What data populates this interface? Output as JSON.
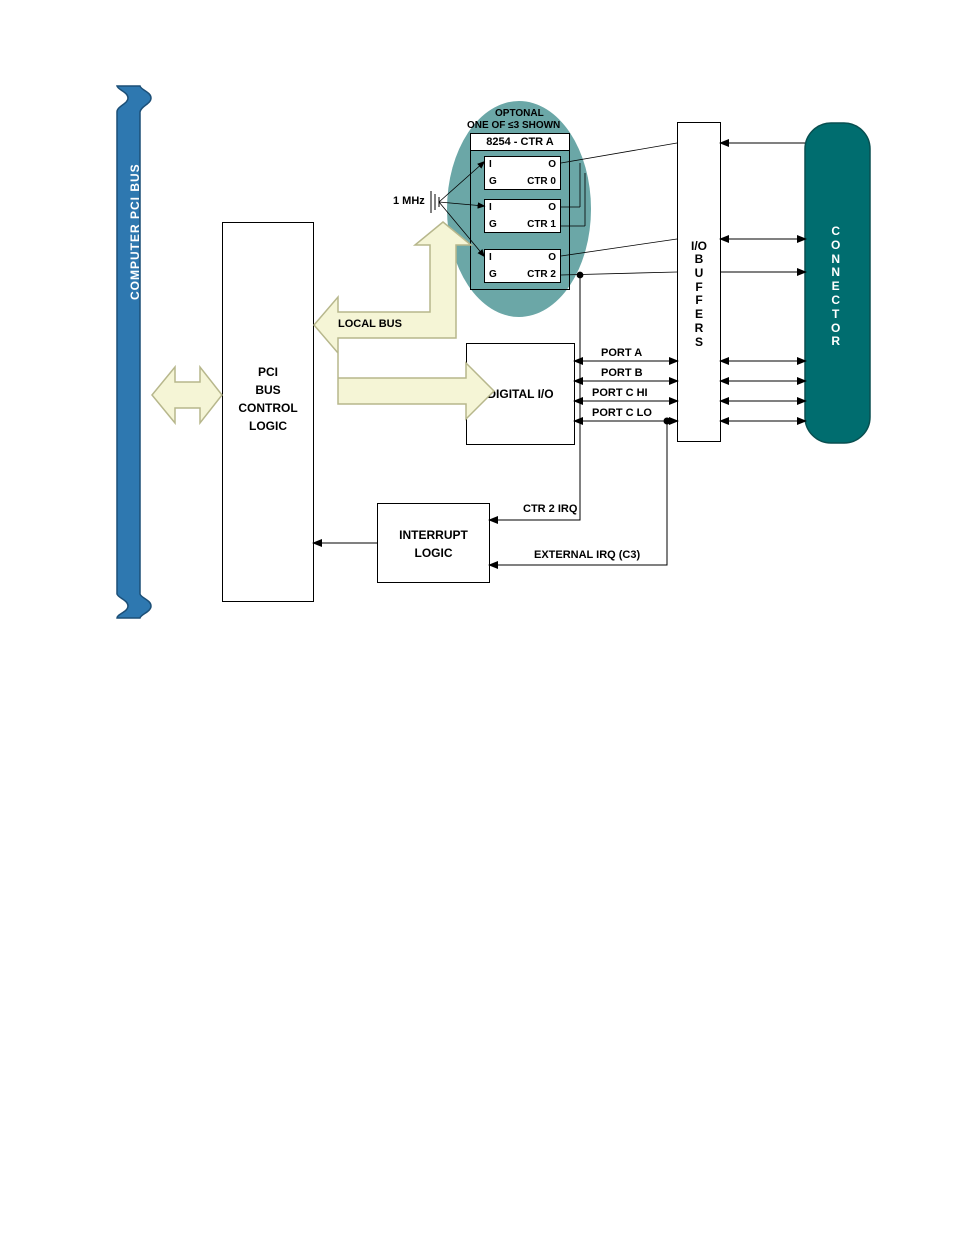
{
  "left_bus": {
    "label": "COMPUTER PCI BUS"
  },
  "pci": {
    "line1": "PCI",
    "line2": "BUS",
    "line3": "CONTROL",
    "line4": "LOGIC"
  },
  "local_bus": "LOCAL BUS",
  "digital_io": "DIGITAL I/O",
  "interrupt": {
    "line1": "INTERRUPT",
    "line2": "LOGIC"
  },
  "counter": {
    "header1": "OPTONAL",
    "header2": "ONE OF ≤3 SHOWN",
    "title": "8254 - CTR A",
    "ctr0": "CTR 0",
    "ctr1": "CTR 1",
    "ctr2": "CTR 2",
    "i": "I",
    "o": "O",
    "g": "G",
    "clock": "1 MHz"
  },
  "ports": {
    "a": "PORT A",
    "b": "PORT B",
    "chi": "PORT C HI",
    "clo": "PORT C LO"
  },
  "io_buffers": {
    "line1": "I/O",
    "stack": "BUFFERS"
  },
  "connector": "CONNECTOR",
  "irq": {
    "ctr2": "CTR 2 IRQ",
    "ext": "EXTERNAL IRQ (C3)"
  },
  "colors": {
    "bus_blue": "#2e78b0",
    "connector_teal": "#006d6f",
    "oval_fill": "#6ba7a7",
    "big_arrow": "#f5f5d6",
    "big_arrow_stroke": "#b7b78c"
  }
}
